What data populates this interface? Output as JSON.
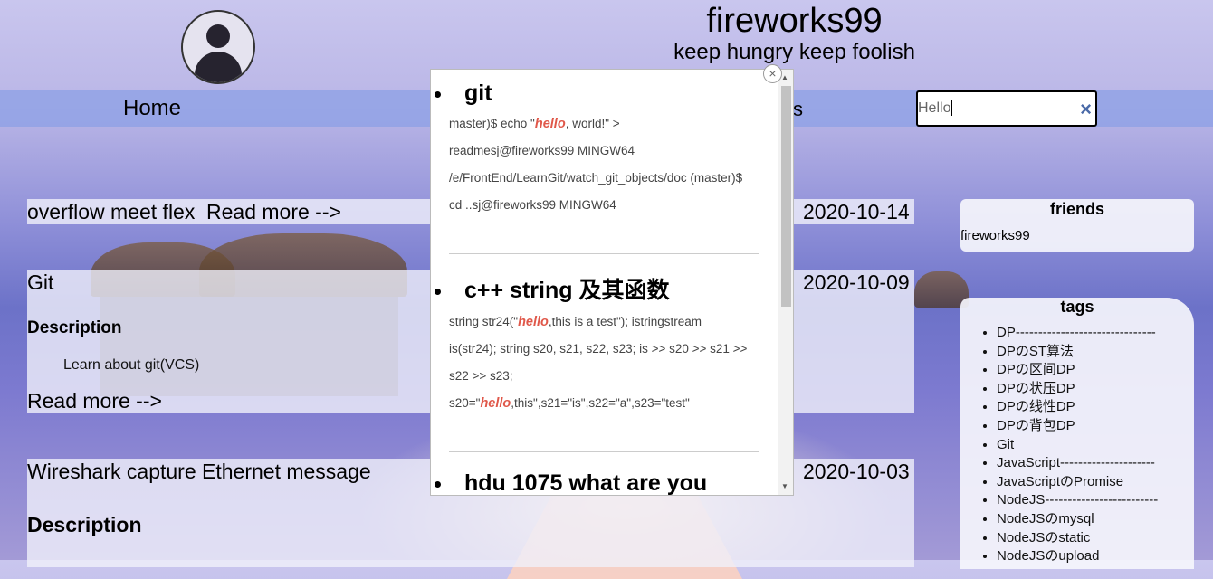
{
  "header": {
    "title": "fireworks99",
    "subtitle": "keep hungry keep foolish"
  },
  "nav": {
    "home": "Home",
    "partial": "s"
  },
  "search": {
    "value": "Hello",
    "clear_icon": "×"
  },
  "posts": [
    {
      "title": "overflow meet flex",
      "read_more": "Read more -->",
      "date": "2020-10-14"
    },
    {
      "title": "Git",
      "date": "2020-10-09",
      "desc_heading": "Description",
      "desc": "Learn about git(VCS)",
      "read_more": "Read more -->"
    },
    {
      "title": "Wireshark capture Ethernet message",
      "date": "2020-10-03",
      "desc_heading": "Description"
    }
  ],
  "friends": {
    "heading": "friends",
    "items": [
      "fireworks99"
    ]
  },
  "tags": {
    "heading": "tags",
    "items": [
      "DP-------------------------------",
      "DPのST算法",
      "DPの区间DP",
      "DPの状压DP",
      "DPの线性DP",
      "DPの背包DP",
      "Git",
      "JavaScript---------------------",
      "JavaScriptのPromise",
      "NodeJS-------------------------",
      "NodeJSのmysql",
      "NodeJSのstatic",
      "NodeJSのupload"
    ]
  },
  "search_results": {
    "close_icon": "×",
    "r1": {
      "title": "git",
      "l1a": "master)$ echo \"",
      "l1hl": "hello",
      "l1b": ", world!\" >",
      "l2": "readmesj@fireworks99 MINGW64",
      "l3": "/e/FrontEnd/LearnGit/watch_git_objects/doc (master)$",
      "l4": "cd ..sj@fireworks99 MINGW64"
    },
    "r2": {
      "title": "c++ string 及其函数",
      "l1a": "string str24(\"",
      "l1hl": "hello",
      "l1b": ",this is a test\"); istringstream",
      "l2": "is(str24); string s20, s21, s22, s23; is >> s20 >> s21 >>",
      "l3": "s22 >> s23;",
      "l4a": "s20=\"",
      "l4hl": "hello",
      "l4b": ",this\",s21=\"is\",s22=\"a\",s23=\"test\""
    },
    "r3": {
      "title": "hdu 1075 what are you"
    }
  }
}
